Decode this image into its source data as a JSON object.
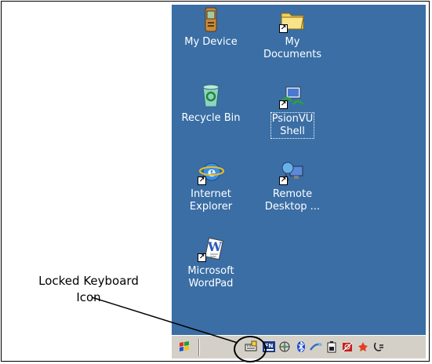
{
  "desktop": {
    "icons": [
      {
        "label": "My Device",
        "icon": "handheld-device-icon"
      },
      {
        "label": "My\nDocuments",
        "icon": "folder-icon"
      },
      {
        "label": "Recycle Bin",
        "icon": "recycle-bin-icon"
      },
      {
        "label": "PsionVU\nShell",
        "icon": "psionvu-shell-icon"
      },
      {
        "label": "Internet\nExplorer",
        "icon": "internet-explorer-icon"
      },
      {
        "label": "Remote\nDesktop ...",
        "icon": "remote-desktop-icon"
      },
      {
        "label": "Microsoft\nWordPad",
        "icon": "wordpad-icon"
      }
    ],
    "background": "#3a6ea5"
  },
  "taskbar": {
    "background": "#d4d0c8",
    "items": [
      "start-icon",
      "locked-keyboard-icon",
      "fn-key-icon",
      "network-icon",
      "bluetooth-icon",
      "connection-icon",
      "battery-icon",
      "radio-off-icon",
      "tools-icon",
      "power-icon"
    ]
  },
  "callout": {
    "line1": "Locked Keyboard",
    "line2": "Icon"
  }
}
